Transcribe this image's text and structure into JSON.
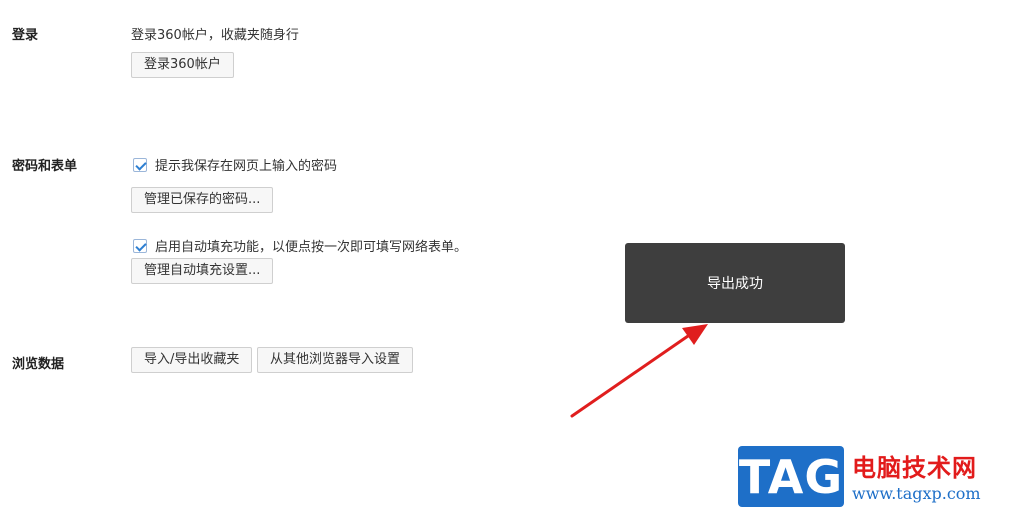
{
  "login": {
    "title": "登录",
    "description": "登录360帐户，收藏夹随身行",
    "login_button": "登录360帐户"
  },
  "passwords": {
    "title": "密码和表单",
    "save_prompt_label": "提示我保存在网页上输入的密码",
    "save_prompt_checked": true,
    "manage_passwords_button": "管理已保存的密码...",
    "autofill_label": "启用自动填充功能，以便点按一次即可填写网络表单。",
    "autofill_checked": true,
    "manage_autofill_button": "管理自动填充设置..."
  },
  "browsing_data": {
    "title": "浏览数据",
    "import_export_button": "导入/导出收藏夹",
    "import_other_button": "从其他浏览器导入设置"
  },
  "toast": {
    "message": "导出成功"
  },
  "annotation": {
    "arrow_color": "#e01e1e"
  },
  "watermark": {
    "logo_text": "TAG",
    "site_name": "电脑技术网",
    "url": "www.tagxp.com",
    "logo_color": "#1e6fc8",
    "title_color": "#e21b1b"
  }
}
